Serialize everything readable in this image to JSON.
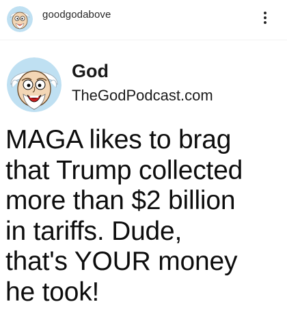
{
  "header": {
    "username": "goodgodabove",
    "avatar_icon": "cartoon-god-face-icon",
    "more_icon": "more-options-icon"
  },
  "post": {
    "author_name": "God",
    "author_site": "TheGodPodcast.com",
    "avatar_icon": "cartoon-god-face-icon",
    "text_lines": [
      "MAGA likes to brag",
      "that Trump collected",
      "more than $2 billion",
      "in tariffs. Dude,",
      "that's YOUR money",
      "he took!"
    ]
  },
  "colors": {
    "background": "#ffffff",
    "text": "#0d0d0d",
    "avatar_backdrop": "#bfe0f2"
  }
}
